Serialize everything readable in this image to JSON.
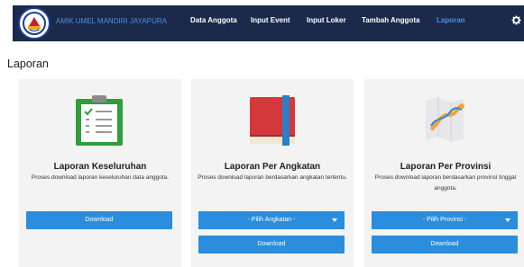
{
  "brand": {
    "name": "AMIK UMEL MANDIRI JAYAPURA"
  },
  "nav": {
    "items": [
      {
        "label": "Data Anggota",
        "active": false
      },
      {
        "label": "Input Event",
        "active": false
      },
      {
        "label": "Input Loker",
        "active": false
      },
      {
        "label": "Tambah Anggota",
        "active": false
      },
      {
        "label": "Laporan",
        "active": true
      }
    ],
    "settings_icon": "gear-icon"
  },
  "page": {
    "title": "Laporan"
  },
  "cards": [
    {
      "title": "Laporan Keseluruhan",
      "description": "Proses download laporan keseluruhan data anggota.",
      "icon": "clipboard-checklist-icon",
      "download_label": "Download"
    },
    {
      "title": "Laporan Per Angkatan",
      "description": "Proses download laporan berdasarkan angkatan tertentu.",
      "icon": "book-icon",
      "select_label": "- Pilih Angkatan -",
      "download_label": "Download"
    },
    {
      "title": "Laporan Per Provinsi",
      "description": "Proses download laporan berdasarkan provinsi tinggal anggota.",
      "icon": "map-route-icon",
      "select_label": "- Pilih Provinsi -",
      "download_label": "Download"
    }
  ],
  "colors": {
    "navbar": "#1b2a4b",
    "accent": "#2a8ddd",
    "active_nav": "#4a90e2",
    "card_bg": "#f3f3f3"
  }
}
